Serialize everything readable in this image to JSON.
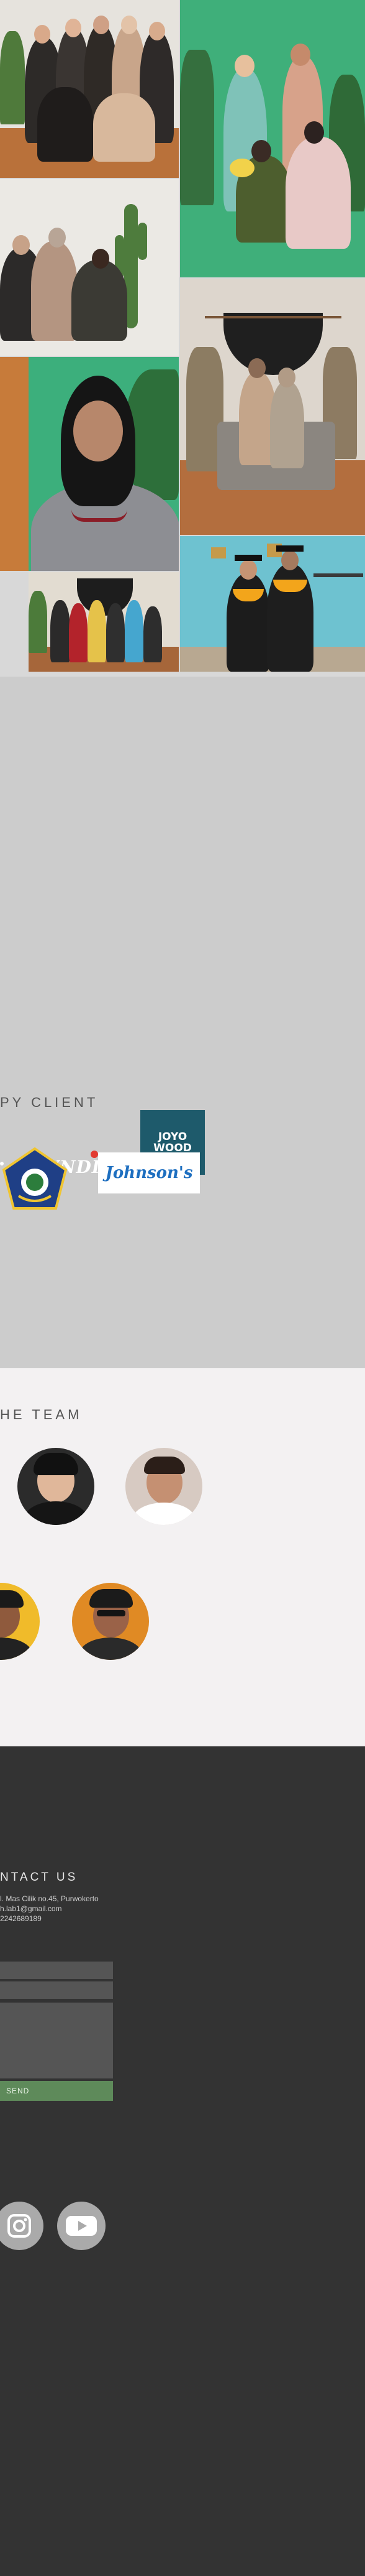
{
  "gallery": {
    "photos": [
      {
        "name": "group-of-women-photo",
        "label": "Group of women in studio"
      },
      {
        "name": "green-backdrop-group-photo",
        "label": "Group on green backdrop"
      },
      {
        "name": "family-cactus-photo",
        "label": "Family with cactus"
      },
      {
        "name": "couple-macrame-photo",
        "label": "Couple with macrame"
      },
      {
        "name": "hijab-portrait-photo",
        "label": "Hijab portrait"
      },
      {
        "name": "family-group-photo",
        "label": "Family group"
      },
      {
        "name": "graduation-photo",
        "label": "Graduation couple"
      }
    ]
  },
  "clients": {
    "title": "PY CLIENT",
    "logos": [
      {
        "name": "hyndia-logo",
        "text": "HYNDIA"
      },
      {
        "name": "joyo-wood-logo",
        "line1": "JOYO",
        "line2": "WOOD"
      },
      {
        "name": "emblem-logo",
        "text": ""
      },
      {
        "name": "johnsons-logo",
        "text": "Johnson's"
      }
    ]
  },
  "team": {
    "title": "HE TEAM"
  },
  "contact": {
    "title": "NTACT US",
    "address": "l. Mas Cilik no.45, Purwokerto",
    "email": "h.lab1@gmail.com",
    "phone": "2242689189",
    "send_label": "SEND",
    "social": [
      {
        "name": "instagram-icon"
      },
      {
        "name": "youtube-icon"
      }
    ]
  }
}
